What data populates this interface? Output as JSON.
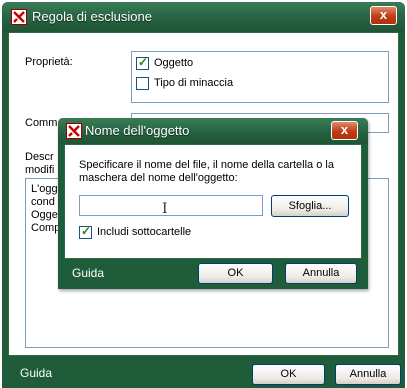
{
  "window": {
    "title": "Regola di esclusione",
    "close_glyph": "x",
    "labels": {
      "properties": "Proprietà:",
      "comment": "Comm",
      "description_1": "Descr",
      "description_2": "modifi"
    },
    "properties_options": [
      {
        "label": "Oggetto",
        "checked": true
      },
      {
        "label": "Tipo di minaccia",
        "checked": false
      }
    ],
    "description_lines": [
      "L'ogg",
      "cond",
      "Ogge",
      "Comp"
    ],
    "footer": {
      "help": "Guida",
      "ok": "OK",
      "cancel": "Annulla"
    }
  },
  "dialog": {
    "title": "Nome dell'oggetto",
    "close_glyph": "x",
    "instruction": "Specificare il nome del file, il nome della cartella o la maschera del nome dell'oggetto:",
    "input_value": "",
    "browse_label": "Sfoglia...",
    "include_subfolders": {
      "label": "Includi sottocartelle",
      "checked": true
    },
    "footer": {
      "help": "Guida",
      "ok": "OK",
      "cancel": "Annulla"
    }
  },
  "colors": {
    "frame_green": "#1f5c3a",
    "close_red": "#c23c16",
    "check_green": "#1b8a1b"
  },
  "icons": [
    "app-logo-icon",
    "close-icon",
    "checkmark-icon",
    "text-cursor-icon"
  ]
}
